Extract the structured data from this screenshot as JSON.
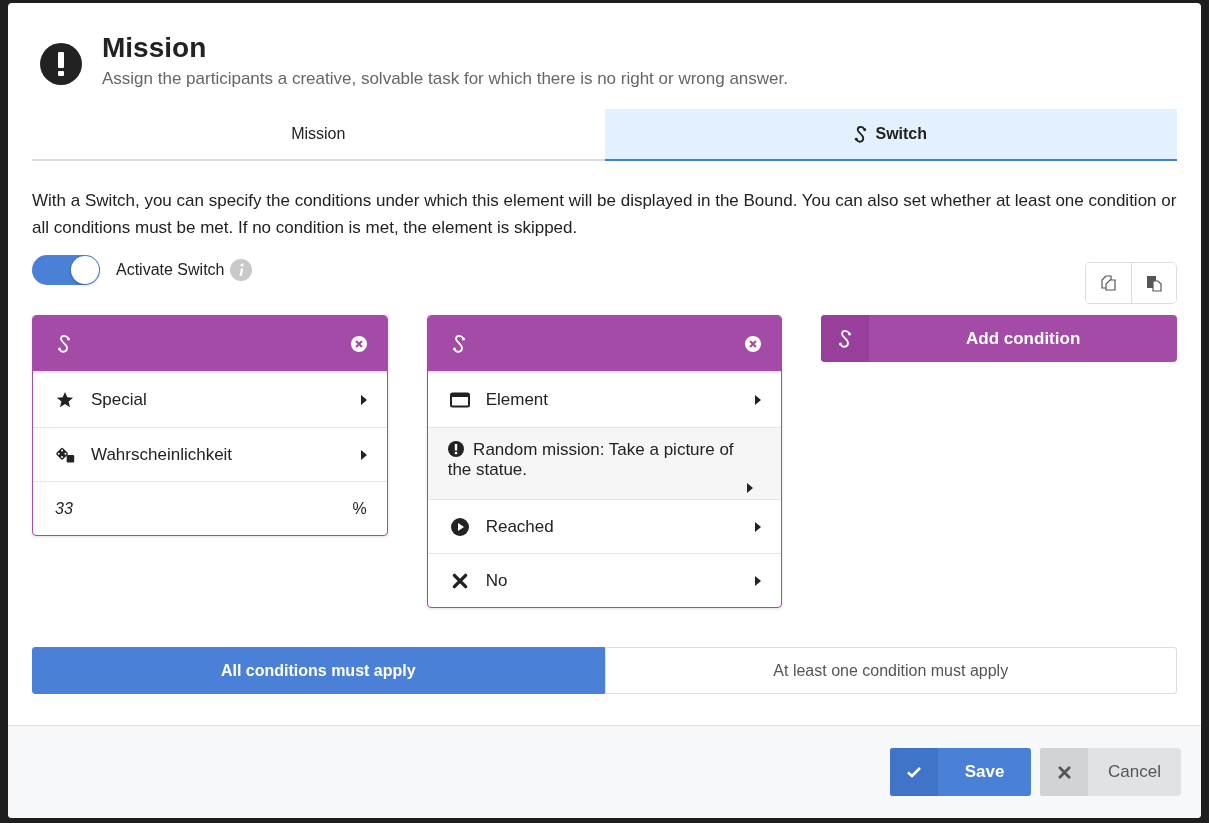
{
  "header": {
    "title": "Mission",
    "description": "Assign the participants a creative, solvable task for which there is no right or wrong answer."
  },
  "tabs": [
    {
      "label": "Mission",
      "selected": false,
      "kind": "plain"
    },
    {
      "label": "Switch",
      "selected": true,
      "kind": "switch"
    }
  ],
  "intro": "With a Switch, you can specify the conditions under which this element will be displayed in the Bound. You can also set whether at least one condition or all conditions must be met. If no condition is met, the element is skipped.",
  "activate_switch": {
    "label": "Activate Switch",
    "on": true
  },
  "conditions": [
    {
      "rows": [
        {
          "kind": "star",
          "label": "Special"
        },
        {
          "kind": "dice",
          "label": "Wahrscheinlichkeit"
        },
        {
          "kind": "input",
          "value": "33",
          "unit": "%"
        }
      ]
    },
    {
      "rows": [
        {
          "kind": "window",
          "label": "Element"
        },
        {
          "kind": "alert",
          "label": "Random mission: Take a picture of the statue."
        },
        {
          "kind": "play",
          "label": "Reached"
        },
        {
          "kind": "cross",
          "label": "No"
        }
      ]
    }
  ],
  "add_condition": "Add condition",
  "modes": [
    {
      "label": "All conditions must apply",
      "selected": true
    },
    {
      "label": "At least one condition must apply",
      "selected": false
    }
  ],
  "footer": {
    "save": "Save",
    "cancel": "Cancel"
  }
}
